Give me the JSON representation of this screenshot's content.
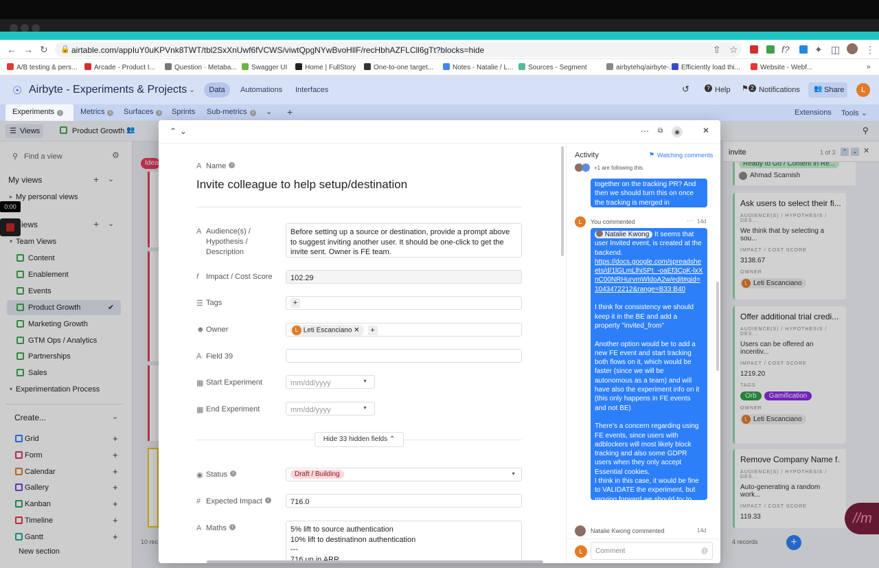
{
  "browser": {
    "url": "airtable.com/appIuY0uKPVnk8TWT/tbl2SxXnUwf6fVCWS/viwtQpgNYwBvoHllF/recHbhAZFLCll6gTt?blocks=hide",
    "bookmarks": [
      "A/B testing & pers...",
      "Arcade - Product I...",
      "Question · Metaba...",
      "Swagger UI",
      "Home | FullStory",
      "One-to-one target...",
      "Notes - Natalie / L...",
      "Sources - Segment",
      "airbytehq/airbyte-...",
      "Efficiently load thi...",
      "Website - Webf..."
    ],
    "bookmark_colors": [
      "#e53935",
      "#d32f2f",
      "#777777",
      "#6cb33f",
      "#222222",
      "#333333",
      "#4285f4",
      "#52bd95",
      "#888888",
      "#3b4cca",
      "#e53935"
    ]
  },
  "header": {
    "title": "Airbyte - Experiments & Projects",
    "nav": [
      "Data",
      "Automations",
      "Interfaces"
    ],
    "help": "Help",
    "notifications": "Notifications",
    "notif_count": "2",
    "share": "Share",
    "avatar": "L"
  },
  "tabs": {
    "items": [
      "Experiments",
      "Metrics",
      "Surfaces",
      "Sprints",
      "Sub-metrics"
    ],
    "extensions": "Extensions",
    "tools": "Tools"
  },
  "viewbar": {
    "views": "Views",
    "current_view": "Product Growth"
  },
  "sidebar": {
    "find": "Find a view",
    "my_views": "My views",
    "my_personal": "My personal views",
    "video_time": "0:00",
    "views_label": "iews",
    "team_views": "Team Views",
    "items": [
      "Content",
      "Enablement",
      "Events",
      "Product Growth",
      "Marketing Growth",
      "GTM Ops / Analytics",
      "Partnerships",
      "Sales"
    ],
    "experimentation": "Experimentation Process",
    "create": "Create...",
    "create_items": [
      "Grid",
      "Form",
      "Calendar",
      "Gallery",
      "Kanban",
      "Timeline",
      "Gantt"
    ],
    "create_colors": [
      "#2d7ff9",
      "#e0336e",
      "#e07b28",
      "#7a3ddf",
      "#23a364",
      "#e53935",
      "#20a79c"
    ],
    "new_section": "New section"
  },
  "modal": {
    "name_label": "Name",
    "name_value": "Invite colleague to help setup/destination",
    "fields": {
      "audience_label": "Audience(s) / Hypothesis / Description",
      "audience_value": "Before setting up a source or destination, provide a prompt above to suggest inviting another user. It should be one-click to get the invite sent. Owner is FE team.",
      "impact_label": "Impact / Cost Score",
      "impact_value": "102.29",
      "tags_label": "Tags",
      "owner_label": "Owner",
      "owner_value": "Leti Escanciano",
      "field39_label": "Field 39",
      "start_label": "Start Experiment",
      "end_label": "End Experiment",
      "date_placeholder": "mm/dd/yyyy",
      "hide_button": "Hide 33 hidden fields",
      "status_label": "Status",
      "status_value": "Draft / Building",
      "expected_label": "Expected Impact",
      "expected_value": "716.0",
      "maths_label": "Maths",
      "maths_lines": [
        "5% lift to source authentication",
        "10% lift to destinatinon authentication",
        "---",
        "716 up in ARR"
      ]
    }
  },
  "activity": {
    "title": "Activity",
    "watching": "Watching comments",
    "following": "+1 are following this.",
    "prev_bubble": "together on the tracking PR? And then we should turn this on once the tracking is merged in",
    "commenter": "You commented",
    "comment_age": "14d",
    "mention": "Natalie Kwong",
    "comment_p1": "It seems that user Invited event, is created at the backend.",
    "comment_link": "https://docs.google.com/spreadsheets/d/1lGLmLlhiSPt_-oaEf3CpK-lxXnC00NRHurvmWldoA2w/edit#gid=1043472212&range=B33:B40",
    "comment_p2": "I think for consistency we should keep it in the BE and add a property \"invited_from\"",
    "comment_p3": "Another option would be to add a new FE event and start tracking both flows on it, which would be faster (since we will be autonomous as a team) and will have also the experiment info on it (this only happens in FE events and not BE)",
    "comment_p4": "There's a concern regarding using FE events, since users with adblockers will most likely block tracking and also some GDPR users when they only accept Essential cookies.",
    "comment_p5": "I think in this case, it would be fine to VALIDATE the experiment, but moving forward we should try to move events to BE",
    "next_commenter": "Natalie Kwong commented",
    "next_age": "14d",
    "comment_placeholder": "Comment"
  },
  "right": {
    "search": "invite",
    "count": "1 of 3",
    "top_chip": "Ready to Go / Content in Re...",
    "top_owner": "Ahmad Scarnish",
    "cards": [
      {
        "title": "Ask users to select their fi...",
        "aud_label": "AUDIENCE(S) / HYPOTHESIS / DES...",
        "aud": "We think that by selecting a sou...",
        "score_label": "IMPACT / COST SCORE",
        "score": "3138.67",
        "owner_label": "OWNER",
        "owner": "Leti Escanciano"
      },
      {
        "title": "Offer additional trial credi...",
        "aud_label": "AUDIENCE(S) / HYPOTHESIS / DES...",
        "aud": "Users can be offered an incentiv...",
        "score_label": "IMPACT / COST SCORE",
        "score": "1219.20",
        "tags_label": "TAGS",
        "tags": [
          "Orb",
          "Gamification"
        ],
        "owner_label": "OWNER",
        "owner": "Leti Escanciano"
      },
      {
        "title": "Remove Company Name f...",
        "aud_label": "AUDIENCE(S) / HYPOTHESIS / DES...",
        "aud": "Auto-generating a random work...",
        "score_label": "IMPACT / COST SCORE",
        "score": "119.33"
      }
    ],
    "records": "4 records"
  },
  "background": {
    "ideas_chip": "Idea",
    "records_left": "10 rec"
  }
}
